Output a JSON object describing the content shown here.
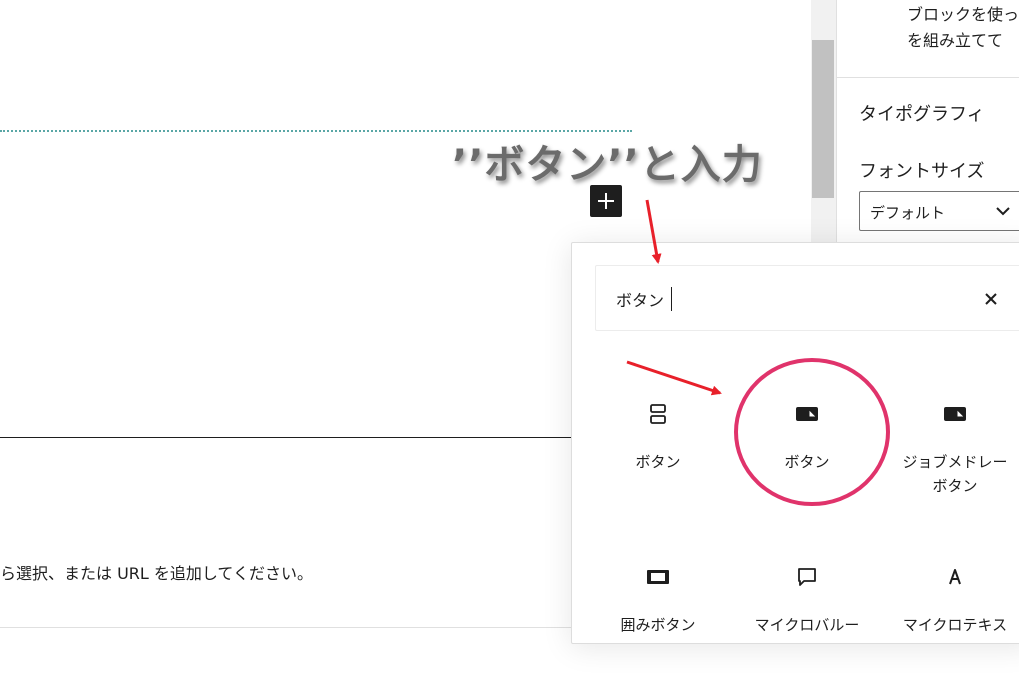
{
  "editor": {
    "placeholder_text": "ら選択、または URL を追加してください。"
  },
  "sidebar": {
    "description": "ブロックを使っ\nを組み立てて",
    "typography_heading": "タイポグラフィ",
    "font_size_label": "フォントサイズ",
    "font_size_value": "デフォルト"
  },
  "annotation": {
    "text": "’’ボタン’’と入力",
    "arrow_color": "#e8202a",
    "circle_color": "#e0336b"
  },
  "inserter": {
    "search_value": "ボタン",
    "blocks": [
      {
        "label": "ボタン",
        "icon": "buttons-icon"
      },
      {
        "label": "ボタン",
        "icon": "button-icon"
      },
      {
        "label": "ジョブメドレーボタン",
        "line1": "ジョブメドレー",
        "line2": "ボタン",
        "icon": "button-icon"
      },
      {
        "label": "囲みボタン",
        "icon": "boxed-button-icon"
      },
      {
        "label": "マイクロバルー",
        "icon": "speech-bubble-icon"
      },
      {
        "label": "マイクロテキス",
        "icon": "letter-a-icon"
      }
    ]
  },
  "colors": {
    "accent_dark": "#1e1e1e",
    "dotted_separator": "#5aa7a6"
  }
}
